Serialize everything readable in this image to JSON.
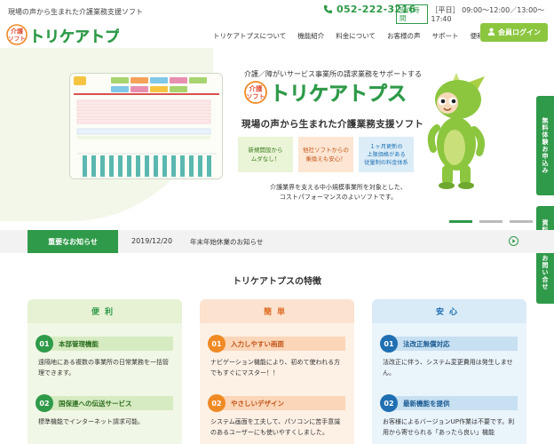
{
  "topbar": {
    "tagline": "現場の声から生まれた介護業務支援ソフト",
    "phone": "052-222-3216",
    "hours_badge": "受付時間",
    "hours": "［平日］ 09:00～12:00／13:00～17:40"
  },
  "header": {
    "logo_small_1": "介護",
    "logo_small_2": "ソフト",
    "logo_text": "トリケアトプス",
    "nav": [
      "トリケアトプスについて",
      "機能紹介",
      "料金について",
      "お客様の声",
      "サポート",
      "便利ツール"
    ],
    "login": "会員ログイン"
  },
  "hero": {
    "subtitle": "介護／障がいサービス事業所の請求業務をサポートする",
    "logo_small_1": "介護",
    "logo_small_2": "ソフト",
    "logo_text": "トリケアトプス",
    "title": "現場の声から生まれた介護業務支援ソフト",
    "features": [
      "新規開設から\nムダなし！",
      "他社ソフトからの\n乗換えも安心！",
      "１ヶ月更新の\n上限価格がある\n従量制の料金体系"
    ],
    "desc_1": "介護業界を支える中小規模事業所を対象とした、",
    "desc_2": "コストパフォーマンスのよいソフトです。",
    "slide_count": 3,
    "active_slide": 1
  },
  "side_tabs": [
    "無料体験お申込み",
    "資料請求・お問い合せ"
  ],
  "news": {
    "label": "重要なお知らせ",
    "date": "2019/12/20",
    "text": "年末年始休業のお知らせ"
  },
  "features": {
    "title": "トリケアトプスの特徴",
    "columns": [
      {
        "heading": "便利",
        "items": [
          {
            "num": "01",
            "title": "本部管理機能",
            "desc": "遠隔地にある複数の事業所の日常業務を一括管理できます。"
          },
          {
            "num": "02",
            "title": "国保連への伝送サービス",
            "desc": "標準機能でインターネット請求可能。"
          }
        ]
      },
      {
        "heading": "簡単",
        "items": [
          {
            "num": "01",
            "title": "入力しやすい画面",
            "desc": "ナビゲーション機能により、初めて使われる方でもすぐにマスター！！"
          },
          {
            "num": "02",
            "title": "やさしいデザイン",
            "desc": "システム画面を工夫して、パソコンに苦手意識のあるユーザーにも使いやすくしました。"
          }
        ]
      },
      {
        "heading": "安心",
        "items": [
          {
            "num": "01",
            "title": "法改正無償対応",
            "desc": "法改正に伴う、システム変更費用は発生しません。"
          },
          {
            "num": "02",
            "title": "最新機能を提供",
            "desc": "お客様によるバージョンUP作業は不要です。利用から寄せられる「あったら良い」機能"
          }
        ]
      }
    ]
  },
  "colors": {
    "brand_green": "#2f9a49",
    "login_green": "#8cc63f",
    "orange": "#f08a24",
    "blue": "#1f6fb2"
  }
}
